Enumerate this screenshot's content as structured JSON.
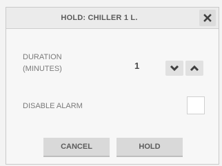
{
  "dialog": {
    "title": "HOLD: CHILLER 1 L.",
    "close_icon": "close-icon"
  },
  "duration": {
    "label_line1": "DURATION",
    "label_line2": "(MINUTES)",
    "value": "1",
    "decrement_icon": "chevron-down-icon",
    "increment_icon": "chevron-up-icon"
  },
  "disable_alarm": {
    "label": "DISABLE ALARM",
    "checked": false
  },
  "buttons": {
    "cancel_label": "CANCEL",
    "hold_label": "HOLD"
  },
  "colors": {
    "title_bar": "#ebebeb",
    "button": "#d9d9d9",
    "icon": "#3f3f3f"
  }
}
